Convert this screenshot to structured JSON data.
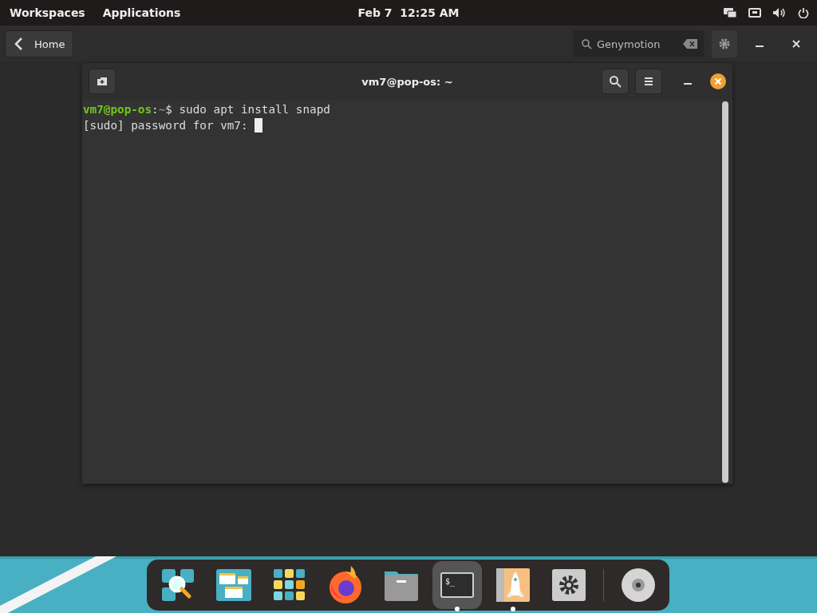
{
  "top_bar": {
    "workspaces": "Workspaces",
    "applications": "Applications",
    "clock": "Feb 7  12:25 AM"
  },
  "header": {
    "back": "Home",
    "search": {
      "value": "Genymotion"
    }
  },
  "terminal": {
    "title": "vm7@pop-os: ~",
    "lines": [
      {
        "cursor": false,
        "segments": [
          {
            "kind": "user",
            "text": "vm7@pop-os"
          },
          {
            "kind": "plain",
            "text": ":"
          },
          {
            "kind": "path",
            "text": "~"
          },
          {
            "kind": "plain",
            "text": "$ sudo apt install snapd"
          }
        ]
      },
      {
        "cursor": true,
        "segments": [
          {
            "kind": "plain",
            "text": "[sudo] password for vm7: "
          }
        ]
      }
    ]
  },
  "dock": [
    {
      "kind": "search",
      "selected": false,
      "running": false
    },
    {
      "kind": "workspaces",
      "selected": false,
      "running": false
    },
    {
      "kind": "apps",
      "selected": false,
      "running": false
    },
    {
      "kind": "firefox",
      "selected": false,
      "running": false
    },
    {
      "kind": "files",
      "selected": false,
      "running": false
    },
    {
      "kind": "terminal",
      "selected": true,
      "running": true,
      "glyph": "$_"
    },
    {
      "kind": "shop",
      "selected": false,
      "running": true
    },
    {
      "kind": "settings",
      "selected": false,
      "running": false
    },
    {
      "kind": "separator"
    },
    {
      "kind": "disc",
      "selected": false,
      "running": false
    }
  ]
}
